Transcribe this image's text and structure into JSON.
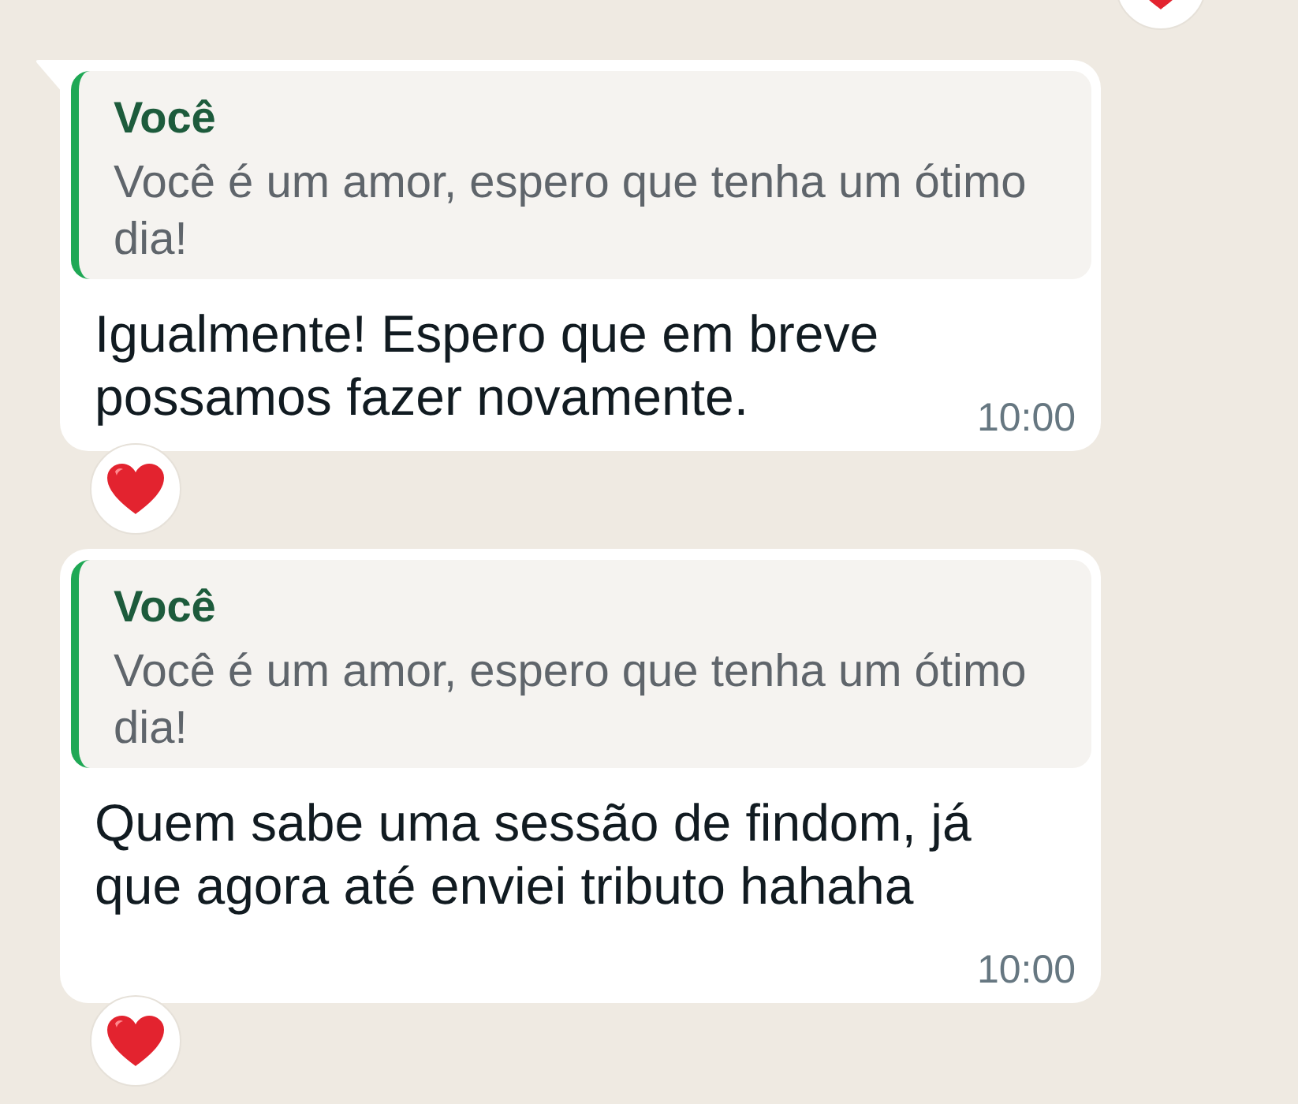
{
  "previous_message": {
    "reaction": {
      "kind": "heart"
    }
  },
  "messages": [
    {
      "tail": true,
      "quote": {
        "author": "Você",
        "text": "Você é um amor, espero que tenha um ótimo dia!"
      },
      "text": "Igualmente! Espero que em breve possamos fazer novamente.",
      "time": "10:00",
      "reaction": {
        "kind": "heart"
      }
    },
    {
      "tail": false,
      "quote": {
        "author": "Você",
        "text": "Você é um amor, espero que tenha um ótimo dia!"
      },
      "text": "Quem sabe uma sessão de findom, já que agora até enviei tributo hahaha",
      "time": "10:00",
      "reaction": {
        "kind": "heart"
      }
    }
  ]
}
